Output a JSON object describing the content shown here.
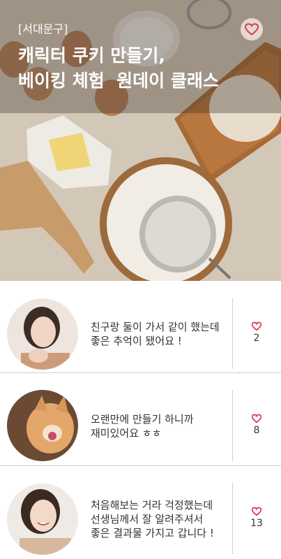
{
  "hero": {
    "tag": "[서대문구]",
    "title_lines": [
      "캐릭터 쿠키 만들기,",
      "베이킹 체험  원데이 클래스"
    ],
    "favorite_icon": "heart-outline-icon"
  },
  "reviews": [
    {
      "comment": "친구랑 둘이 가서 같이 했는데\n좋은 추억이 됐어요 !",
      "likes": "2",
      "avatar": "woman-portrait"
    },
    {
      "comment": "오랜만에 만들기 하니까\n재미있어요 ㅎㅎ",
      "likes": "8",
      "avatar": "cat-photo"
    },
    {
      "comment": "처음해보는 거라 걱정했는데\n선생님께서 잘 알려주셔서\n좋은 결과물 가지고 갑니다 !",
      "likes": "13",
      "avatar": "woman-smiling"
    }
  ],
  "colors": {
    "heart": "#e0334f",
    "text": "#333333"
  }
}
